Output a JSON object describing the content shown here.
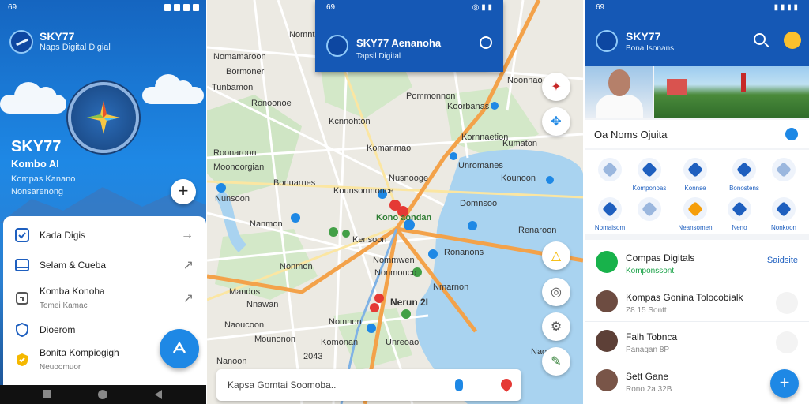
{
  "panel1": {
    "status_time": "69",
    "app_name": "SKY77",
    "app_subtitle": "Naps Digital Digial",
    "brand_big": "SKY77",
    "brand_small": "Kombo AI",
    "tagline_1": "Kompas Kanano",
    "tagline_2": "Nonsarenong",
    "menu": [
      {
        "label": "Kada Digis",
        "sub": "",
        "icon": "check-square-icon",
        "arrow": "→"
      },
      {
        "label": "Selam & Cueba",
        "sub": "",
        "icon": "window-icon",
        "arrow": "↗"
      },
      {
        "label": "Komba Konoha",
        "sub": "Tomei Kamac",
        "icon": "tag-icon",
        "arrow": "↗"
      },
      {
        "label": "Dioerom",
        "sub": "",
        "icon": "shield-icon",
        "arrow": ""
      },
      {
        "label": "Bonita Kompiogigh",
        "sub": "Neuoomuor",
        "icon": "badge-icon",
        "arrow": ""
      }
    ]
  },
  "panel2": {
    "status_time": "69",
    "title": "SKY77 Aenanoha",
    "subtitle": "Tapsil Digital",
    "search_placeholder": "Kapsa Gomtai Soomoba..",
    "labels": [
      {
        "text": "Nomntion"
      },
      {
        "text": "Nomamaroon"
      },
      {
        "text": "Bormoner"
      },
      {
        "text": "Pommonnon"
      },
      {
        "text": "Tunbamon"
      },
      {
        "text": "Ronoonoe"
      },
      {
        "text": "Koorbanas"
      },
      {
        "text": "Noonnao"
      },
      {
        "text": "Kcnnohton"
      },
      {
        "text": "Kornnaetion"
      },
      {
        "text": "Komanmao"
      },
      {
        "text": "Kumaton"
      },
      {
        "text": "Roonaroon"
      },
      {
        "text": "Moonoorgian"
      },
      {
        "text": "Unromanes"
      },
      {
        "text": "Nusnooge"
      },
      {
        "text": "Bonuarnes"
      },
      {
        "text": "Kounsomnonce"
      },
      {
        "text": "Kounoon"
      },
      {
        "text": "Nunsoon"
      },
      {
        "text": "Domnsoo"
      },
      {
        "text": "Kono aondan"
      },
      {
        "text": "Nanmon"
      },
      {
        "text": "Renaroon"
      },
      {
        "text": "Kensoon"
      },
      {
        "text": "Ronanons"
      },
      {
        "text": "Nonmon"
      },
      {
        "text": "Nommwen"
      },
      {
        "text": "Nonmonco"
      },
      {
        "text": "Nmarnon"
      },
      {
        "text": "Mandos"
      },
      {
        "text": "Nnawan"
      },
      {
        "text": "Nomnon"
      },
      {
        "text": "2043"
      },
      {
        "text": "Naoucoon"
      },
      {
        "text": "Mounonon"
      },
      {
        "text": "Komonan"
      },
      {
        "text": "Nerun 2I"
      },
      {
        "text": "Nanoon"
      },
      {
        "text": "Unreoao"
      },
      {
        "text": "Naoum"
      }
    ]
  },
  "panel3": {
    "status_time": "69",
    "title": "SKY77",
    "subtitle": "Bona Isonans",
    "section_title": "Oa Noms Ojuita",
    "grid": [
      {
        "label": "",
        "style": "blank"
      },
      {
        "label": "Komponoas",
        "style": ""
      },
      {
        "label": "Konnse",
        "style": ""
      },
      {
        "label": "Bonostens",
        "style": ""
      },
      {
        "label": "",
        "style": "blank"
      },
      {
        "label": "Nomaisom",
        "style": ""
      },
      {
        "label": "",
        "style": "blank"
      },
      {
        "label": "Neansomen",
        "style": "orange"
      },
      {
        "label": "Neno",
        "style": ""
      },
      {
        "label": "Nonkoon",
        "style": ""
      }
    ],
    "list": [
      {
        "title": "Compas Digitals",
        "sub": "Komponssont",
        "sub_green": true,
        "action": "Saidsite",
        "avatar": "green"
      },
      {
        "title": "Kompas Gonina Tolocobialk",
        "sub": "Z8 15 Sontt",
        "sub_green": false,
        "action": "",
        "avatar": ""
      },
      {
        "title": "Falh Tobnca",
        "sub": "Panagan 8P",
        "sub_green": false,
        "action": "",
        "avatar": ""
      },
      {
        "title": "Sett Gane",
        "sub": "Rono 2a 32B",
        "sub_green": false,
        "action": "",
        "avatar": ""
      }
    ]
  }
}
